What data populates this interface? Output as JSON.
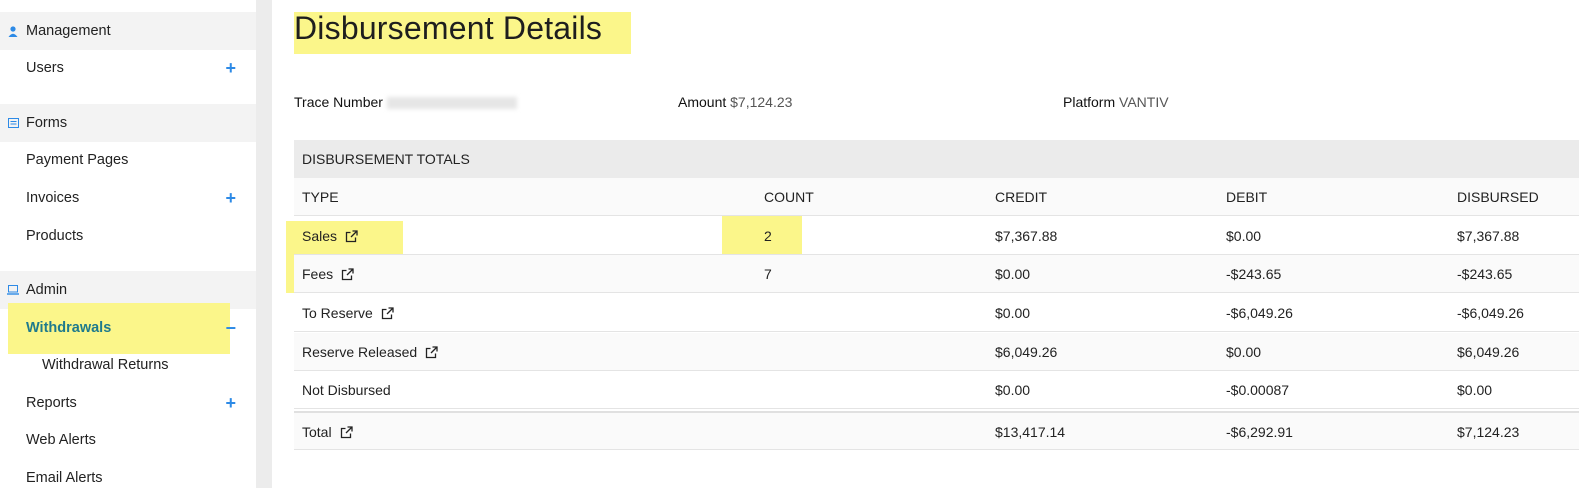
{
  "sidebar": {
    "sections": [
      {
        "label": "Management",
        "icon": "user-icon"
      },
      {
        "label": "Forms",
        "icon": "form-icon"
      },
      {
        "label": "Admin",
        "icon": "laptop-icon"
      }
    ],
    "items": [
      {
        "label": "Users",
        "expand": "+"
      },
      {
        "label": "Payment Pages"
      },
      {
        "label": "Invoices",
        "expand": "+"
      },
      {
        "label": "Products"
      },
      {
        "label": "Withdrawals",
        "expand": "−"
      },
      {
        "label": "Withdrawal Returns"
      },
      {
        "label": "Reports",
        "expand": "+"
      },
      {
        "label": "Web Alerts"
      },
      {
        "label": "Email Alerts"
      }
    ]
  },
  "page": {
    "title": "Disbursement Details",
    "trace_label": "Trace Number",
    "amount_label": "Amount",
    "amount_value": "$7,124.23",
    "platform_label": "Platform",
    "platform_value": "VANTIV"
  },
  "table": {
    "heading": "DISBURSEMENT TOTALS",
    "columns": [
      "TYPE",
      "COUNT",
      "CREDIT",
      "DEBIT",
      "DISBURSED"
    ],
    "rows": [
      {
        "type": "Sales",
        "count": "2",
        "credit": "$7,367.88",
        "debit": "$0.00",
        "disbursed": "$7,367.88",
        "link": true
      },
      {
        "type": "Fees",
        "count": "7",
        "credit": "$0.00",
        "debit": "-$243.65",
        "disbursed": "-$243.65",
        "link": true
      },
      {
        "type": "To Reserve",
        "count": "",
        "credit": "$0.00",
        "debit": "-$6,049.26",
        "disbursed": "-$6,049.26",
        "link": true
      },
      {
        "type": "Reserve Released",
        "count": "",
        "credit": "$6,049.26",
        "debit": "$0.00",
        "disbursed": "$6,049.26",
        "link": true
      },
      {
        "type": "Not Disbursed",
        "count": "",
        "credit": "$0.00",
        "debit": "-$0.00087",
        "disbursed": "$0.00",
        "link": false
      }
    ],
    "total": {
      "type": "Total",
      "credit": "$13,417.14",
      "debit": "-$6,292.91",
      "disbursed": "$7,124.23"
    }
  },
  "colors": {
    "accent": "#2d8ae6",
    "highlight": "#fbf68a",
    "active_text": "#1f7a8c"
  }
}
